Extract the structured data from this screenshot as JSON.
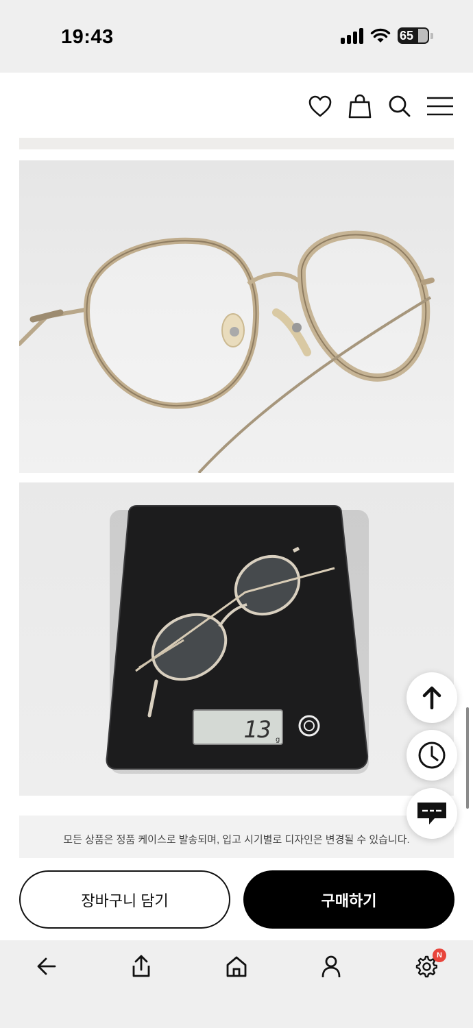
{
  "status_bar": {
    "time": "19:43",
    "battery": "65",
    "icons": [
      "signal-icon",
      "wifi-icon",
      "battery-icon"
    ]
  },
  "header": {
    "icons": [
      "heart-icon",
      "shopping-bag-icon",
      "search-icon",
      "menu-icon"
    ]
  },
  "content": {
    "images": [
      "eyeglasses-photo",
      "eyeglasses-on-scale-photo"
    ],
    "scale_display": "13",
    "scale_unit": "g",
    "notice": "모든 상품은 정품 케이스로 발송되며, 입고 시기별로 디자인은 변경될 수 있습니다."
  },
  "floating_buttons": [
    "scroll-to-top-icon",
    "clock-icon",
    "chat-icon"
  ],
  "actions": {
    "cart_label": "장바구니 담기",
    "buy_label": "구매하기"
  },
  "nav": {
    "items": [
      "back-arrow-icon",
      "share-icon",
      "home-icon",
      "user-icon",
      "settings-icon"
    ],
    "settings_badge": "N"
  },
  "colors": {
    "bar_background": "#efefef",
    "primary": "#000000",
    "badge": "#e8453c"
  }
}
